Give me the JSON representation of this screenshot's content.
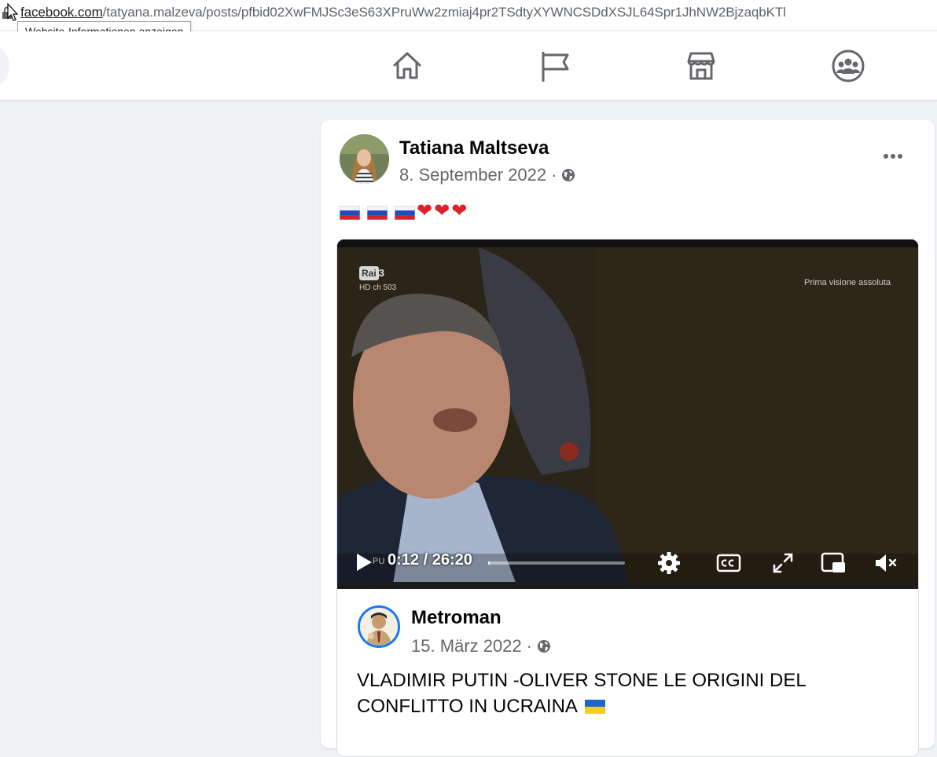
{
  "browser": {
    "url_domain": "facebook.com",
    "url_path": "/tatyana.malzeva/posts/pfbid02XwFMJSc3eS63XPruWw2zmiaj4pr2TSdtyXYWNCSDdXSJL64Spr1JhNW2BjzaqbKTl",
    "tooltip": "Website-Informationen anzeigen"
  },
  "nav": {
    "icons": [
      "home-icon",
      "flag-icon",
      "marketplace-icon",
      "groups-icon"
    ]
  },
  "post": {
    "author": "Tatiana Maltseva",
    "date": "8. September 2022",
    "separator": "·",
    "audience_icon": "globe-icon",
    "text_emoji": [
      "russia-flag",
      "russia-flag",
      "russia-flag",
      "heart",
      "heart",
      "heart"
    ],
    "heart_glyph": "❤",
    "colors": {
      "heart": "#e0202e",
      "link_blue": "#1877f2",
      "background": "#f0f2f5"
    }
  },
  "video": {
    "channel": "Rai",
    "channel_number": "3",
    "channel_sub": "HD ch 503",
    "corner_text": "Prima visione assoluta",
    "overlay_text": "PU",
    "current_time": "0:12",
    "duration": "26:20",
    "time_separator": " / ",
    "progress_fraction": 0.0076
  },
  "shared": {
    "author": "Metroman",
    "date": "15. März 2022",
    "separator": "·",
    "text_line1": "VLADIMIR PUTIN -OLIVER STONE LE ORIGINI DEL",
    "text_line2": "CONFLITTO IN UCRAINA"
  }
}
